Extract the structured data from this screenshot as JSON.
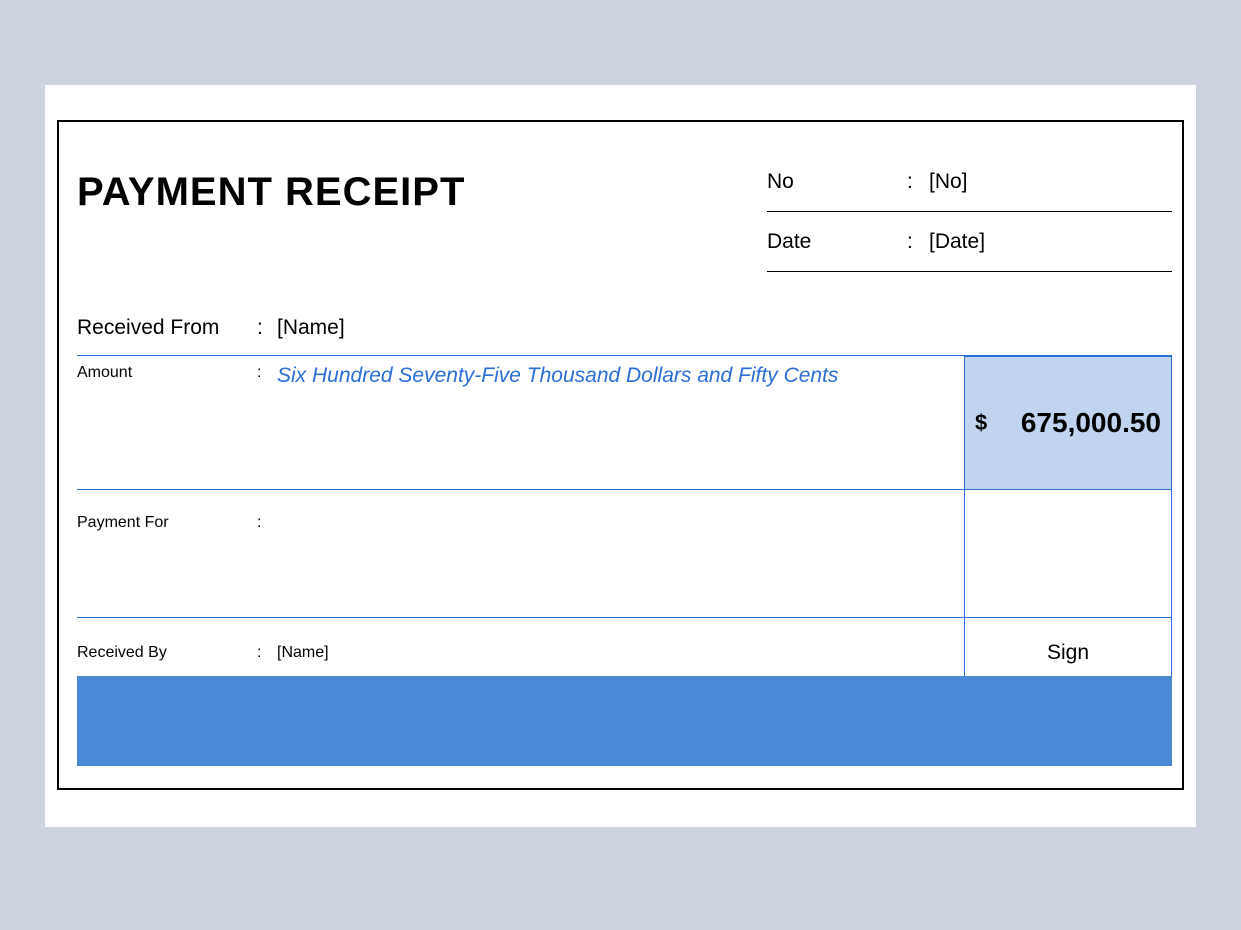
{
  "title": "PAYMENT RECEIPT",
  "meta": {
    "no_label": "No",
    "no_value": "[No]",
    "date_label": "Date",
    "date_value": "[Date]"
  },
  "received_from": {
    "label": "Received From",
    "value": "[Name]"
  },
  "amount": {
    "label": "Amount",
    "words": "Six Hundred Seventy-Five Thousand Dollars and Fifty Cents",
    "currency": "$",
    "value": "675,000.50"
  },
  "payment_for": {
    "label": "Payment For",
    "value": ""
  },
  "received_by": {
    "label": "Received By",
    "value": "[Name]"
  },
  "sign_label": "Sign",
  "colon": ":"
}
